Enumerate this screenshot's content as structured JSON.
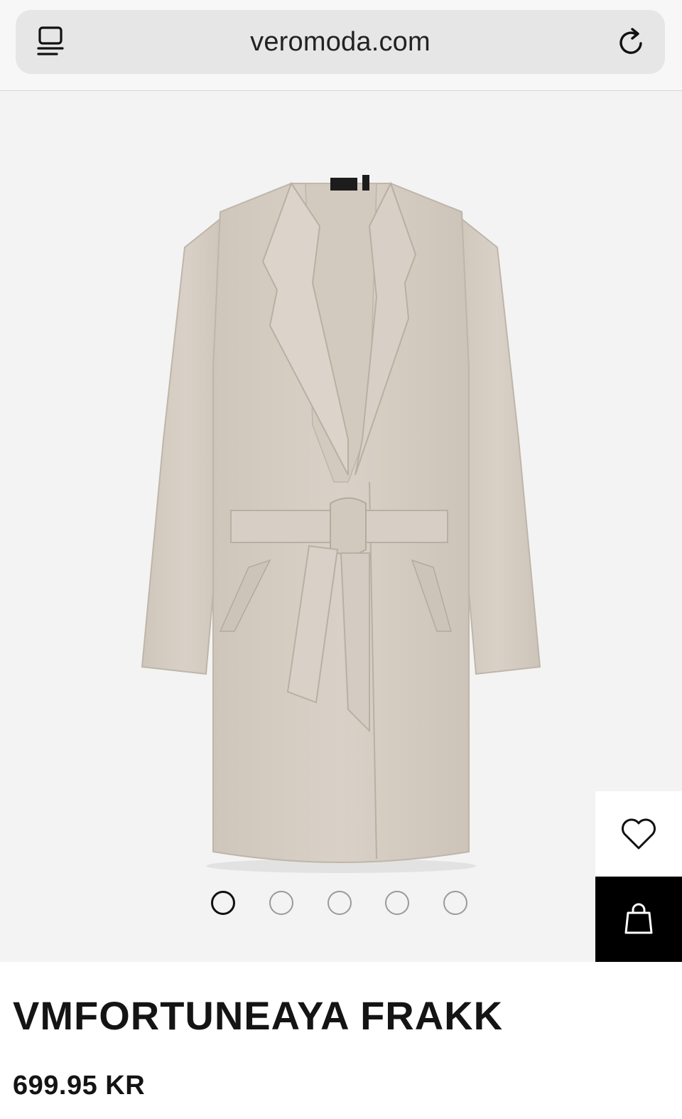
{
  "browser": {
    "url": "veromoda.com",
    "tabs_icon": "tabs-icon",
    "reload_icon": "reload-icon"
  },
  "gallery": {
    "image_count": 5,
    "active_index": 0,
    "product_color": "#d6cec4",
    "label_text": "VERO MODA"
  },
  "actions": {
    "wishlist_icon": "heart-icon",
    "bag_icon": "shopping-bag-icon"
  },
  "product": {
    "name": "VMFORTUNEAYA FRAKK",
    "price": "699.95 KR"
  }
}
